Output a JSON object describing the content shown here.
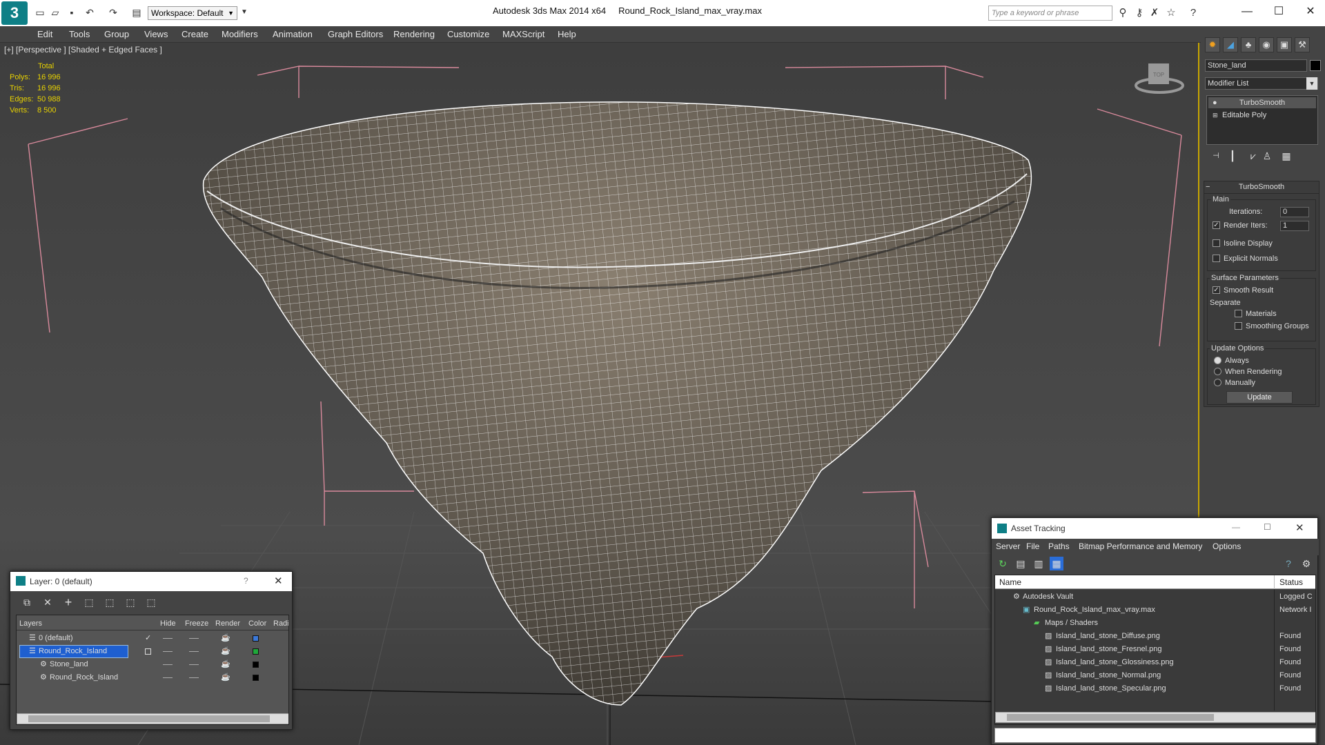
{
  "titlebar": {
    "workspace": "Workspace: Default",
    "app_title": "Autodesk 3ds Max  2014 x64",
    "file_title": "Round_Rock_Island_max_vray.max",
    "search_placeholder": "Type a keyword or phrase"
  },
  "menu": [
    "Edit",
    "Tools",
    "Group",
    "Views",
    "Create",
    "Modifiers",
    "Animation",
    "Graph Editors",
    "Rendering",
    "Customize",
    "MAXScript",
    "Help"
  ],
  "viewport": {
    "label": "[+] [Perspective ] [Shaded + Edged Faces ]",
    "viewcube": "TOP",
    "stats": {
      "header": "Total",
      "rows": [
        {
          "k": "Polys:",
          "v": "16 996"
        },
        {
          "k": "Tris:",
          "v": "16 996"
        },
        {
          "k": "Edges:",
          "v": "50 988"
        },
        {
          "k": "Verts:",
          "v": "8 500"
        }
      ]
    }
  },
  "command_panel": {
    "object_name": "Stone_land",
    "modifier_list": "Modifier List",
    "stack": [
      "TurboSmooth",
      "Editable Poly"
    ],
    "rollout": "TurboSmooth",
    "main": "Main",
    "iterations_label": "Iterations:",
    "iterations": "0",
    "render_iters_label": "Render Iters:",
    "render_iters": "1",
    "isoline": "Isoline Display",
    "explicit": "Explicit Normals",
    "surface": "Surface Parameters",
    "smooth": "Smooth Result",
    "separate": "Separate",
    "materials": "Materials",
    "smoothing": "Smoothing Groups",
    "update_options": "Update Options",
    "always": "Always",
    "when_rendering": "When Rendering",
    "manually": "Manually",
    "update": "Update"
  },
  "layer_panel": {
    "title": "Layer: 0 (default)",
    "help": "?",
    "columns": [
      "Layers",
      "Hide",
      "Freeze",
      "Render",
      "Color",
      "Radi"
    ],
    "rows": [
      {
        "name": "0 (default)",
        "color": "#3b78d8"
      },
      {
        "name": "Round_Rock_Island",
        "color": "#1fa83a"
      },
      {
        "name": "Stone_land",
        "color": "#000000"
      },
      {
        "name": "Round_Rock_Island",
        "color": "#000000"
      }
    ]
  },
  "asset_panel": {
    "title": "Asset Tracking",
    "menu": [
      "Server",
      "File",
      "Paths",
      "Bitmap Performance and Memory",
      "Options"
    ],
    "col_name": "Name",
    "col_status": "Status",
    "rows": [
      {
        "name": "Autodesk Vault",
        "status": "Logged C"
      },
      {
        "name": "Round_Rock_Island_max_vray.max",
        "status": "Network I"
      },
      {
        "name": "Maps / Shaders",
        "status": ""
      },
      {
        "name": "Island_land_stone_Diffuse.png",
        "status": "Found"
      },
      {
        "name": "Island_land_stone_Fresnel.png",
        "status": "Found"
      },
      {
        "name": "Island_land_stone_Glossiness.png",
        "status": "Found"
      },
      {
        "name": "Island_land_stone_Normal.png",
        "status": "Found"
      },
      {
        "name": "Island_land_stone_Specular.png",
        "status": "Found"
      }
    ]
  }
}
